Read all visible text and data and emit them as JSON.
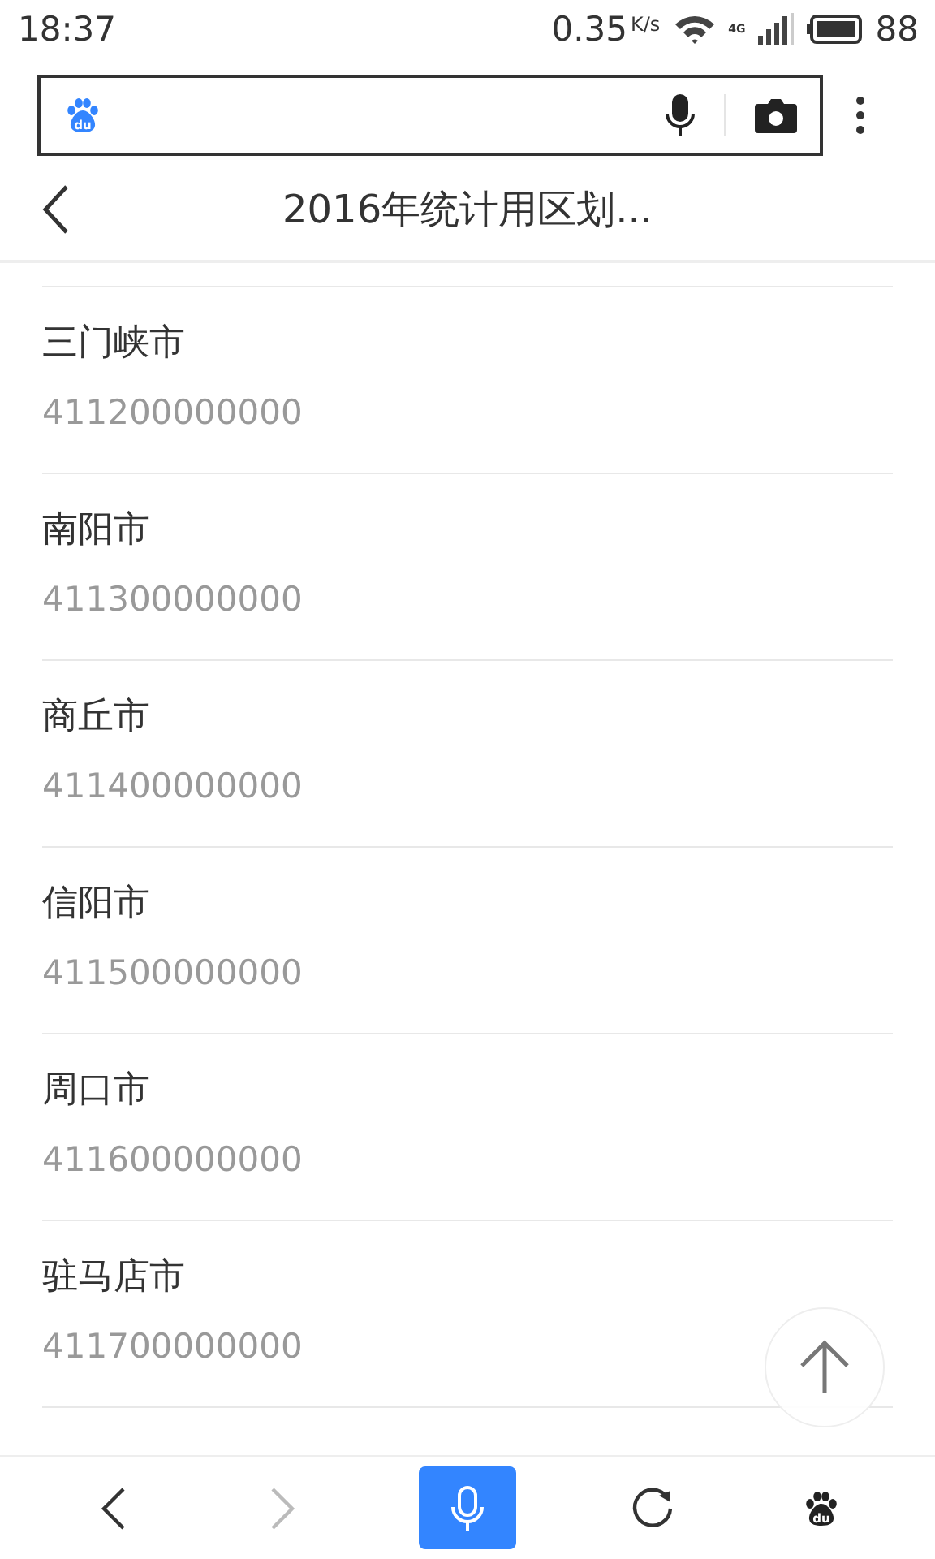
{
  "status_bar": {
    "time": "18:37",
    "speed": "0.35",
    "speed_unit": "K/s",
    "network": "4G",
    "battery": "88"
  },
  "search": {
    "logo_text": "du"
  },
  "header": {
    "title": "2016年统计用区划..."
  },
  "items": [
    {
      "name": "三门峡市",
      "code": "411200000000"
    },
    {
      "name": "南阳市",
      "code": "411300000000"
    },
    {
      "name": "商丘市",
      "code": "411400000000"
    },
    {
      "name": "信阳市",
      "code": "411500000000"
    },
    {
      "name": "周口市",
      "code": "411600000000"
    },
    {
      "name": "驻马店市",
      "code": "411700000000"
    }
  ],
  "toolbar": {
    "forward_disabled": true,
    "logo_text": "du"
  }
}
